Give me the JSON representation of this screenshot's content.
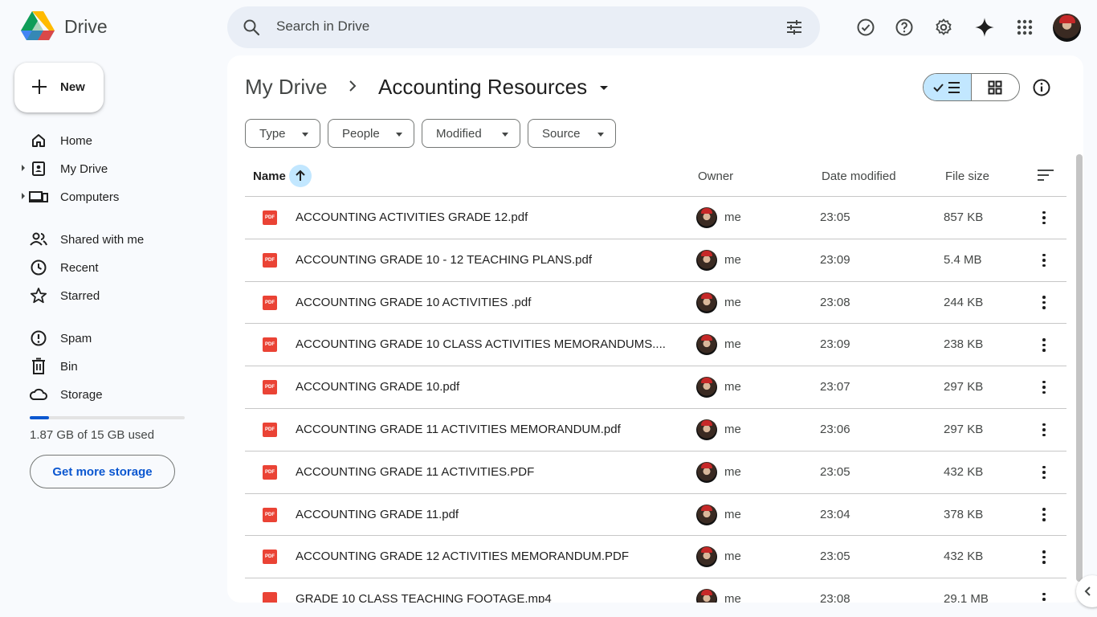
{
  "app": {
    "title": "Drive"
  },
  "search": {
    "placeholder": "Search in Drive"
  },
  "sidebar": {
    "new_label": "New",
    "items": [
      {
        "label": "Home",
        "icon": "home-icon"
      },
      {
        "label": "My Drive",
        "icon": "my-drive-icon"
      },
      {
        "label": "Computers",
        "icon": "computers-icon"
      },
      {
        "label": "Shared with me",
        "icon": "shared-icon"
      },
      {
        "label": "Recent",
        "icon": "clock-icon"
      },
      {
        "label": "Starred",
        "icon": "star-icon"
      },
      {
        "label": "Spam",
        "icon": "spam-icon"
      },
      {
        "label": "Bin",
        "icon": "bin-icon"
      },
      {
        "label": "Storage",
        "icon": "cloud-icon"
      }
    ],
    "storage_text": "1.87 GB of 15 GB used",
    "storage_fraction": 0.125,
    "get_storage_label": "Get more storage"
  },
  "breadcrumb": {
    "root": "My Drive",
    "current": "Accounting Resources"
  },
  "filters": [
    "Type",
    "People",
    "Modified",
    "Source"
  ],
  "table": {
    "headers": {
      "name": "Name",
      "owner": "Owner",
      "date": "Date modified",
      "size": "File size"
    },
    "rows": [
      {
        "name": "ACCOUNTING ACTIVITIES GRADE 12.pdf",
        "owner": "me",
        "date": "23:05",
        "size": "857 KB",
        "type": "pdf"
      },
      {
        "name": "ACCOUNTING GRADE 10 - 12 TEACHING PLANS.pdf",
        "owner": "me",
        "date": "23:09",
        "size": "5.4 MB",
        "type": "pdf"
      },
      {
        "name": "ACCOUNTING GRADE 10 ACTIVITIES .pdf",
        "owner": "me",
        "date": "23:08",
        "size": "244 KB",
        "type": "pdf"
      },
      {
        "name": "ACCOUNTING GRADE 10 CLASS ACTIVITIES MEMORANDUMS....",
        "owner": "me",
        "date": "23:09",
        "size": "238 KB",
        "type": "pdf"
      },
      {
        "name": "ACCOUNTING GRADE 10.pdf",
        "owner": "me",
        "date": "23:07",
        "size": "297 KB",
        "type": "pdf"
      },
      {
        "name": "ACCOUNTING GRADE 11 ACTIVITIES MEMORANDUM.pdf",
        "owner": "me",
        "date": "23:06",
        "size": "297 KB",
        "type": "pdf"
      },
      {
        "name": "ACCOUNTING GRADE 11 ACTIVITIES.PDF",
        "owner": "me",
        "date": "23:05",
        "size": "432 KB",
        "type": "pdf"
      },
      {
        "name": "ACCOUNTING GRADE 11.pdf",
        "owner": "me",
        "date": "23:04",
        "size": "378 KB",
        "type": "pdf"
      },
      {
        "name": "ACCOUNTING GRADE 12 ACTIVITIES MEMORANDUM.PDF",
        "owner": "me",
        "date": "23:05",
        "size": "432 KB",
        "type": "pdf"
      },
      {
        "name": "GRADE 10 CLASS TEACHING FOOTAGE.mp4",
        "owner": "me",
        "date": "23:08",
        "size": "29.1 MB",
        "type": "video"
      }
    ]
  },
  "file_icon_text": "PDF",
  "colors": {
    "accent": "#0b57d0",
    "pdf": "#ea4335",
    "selected": "#c2e7ff",
    "bg": "#f8fafd"
  }
}
